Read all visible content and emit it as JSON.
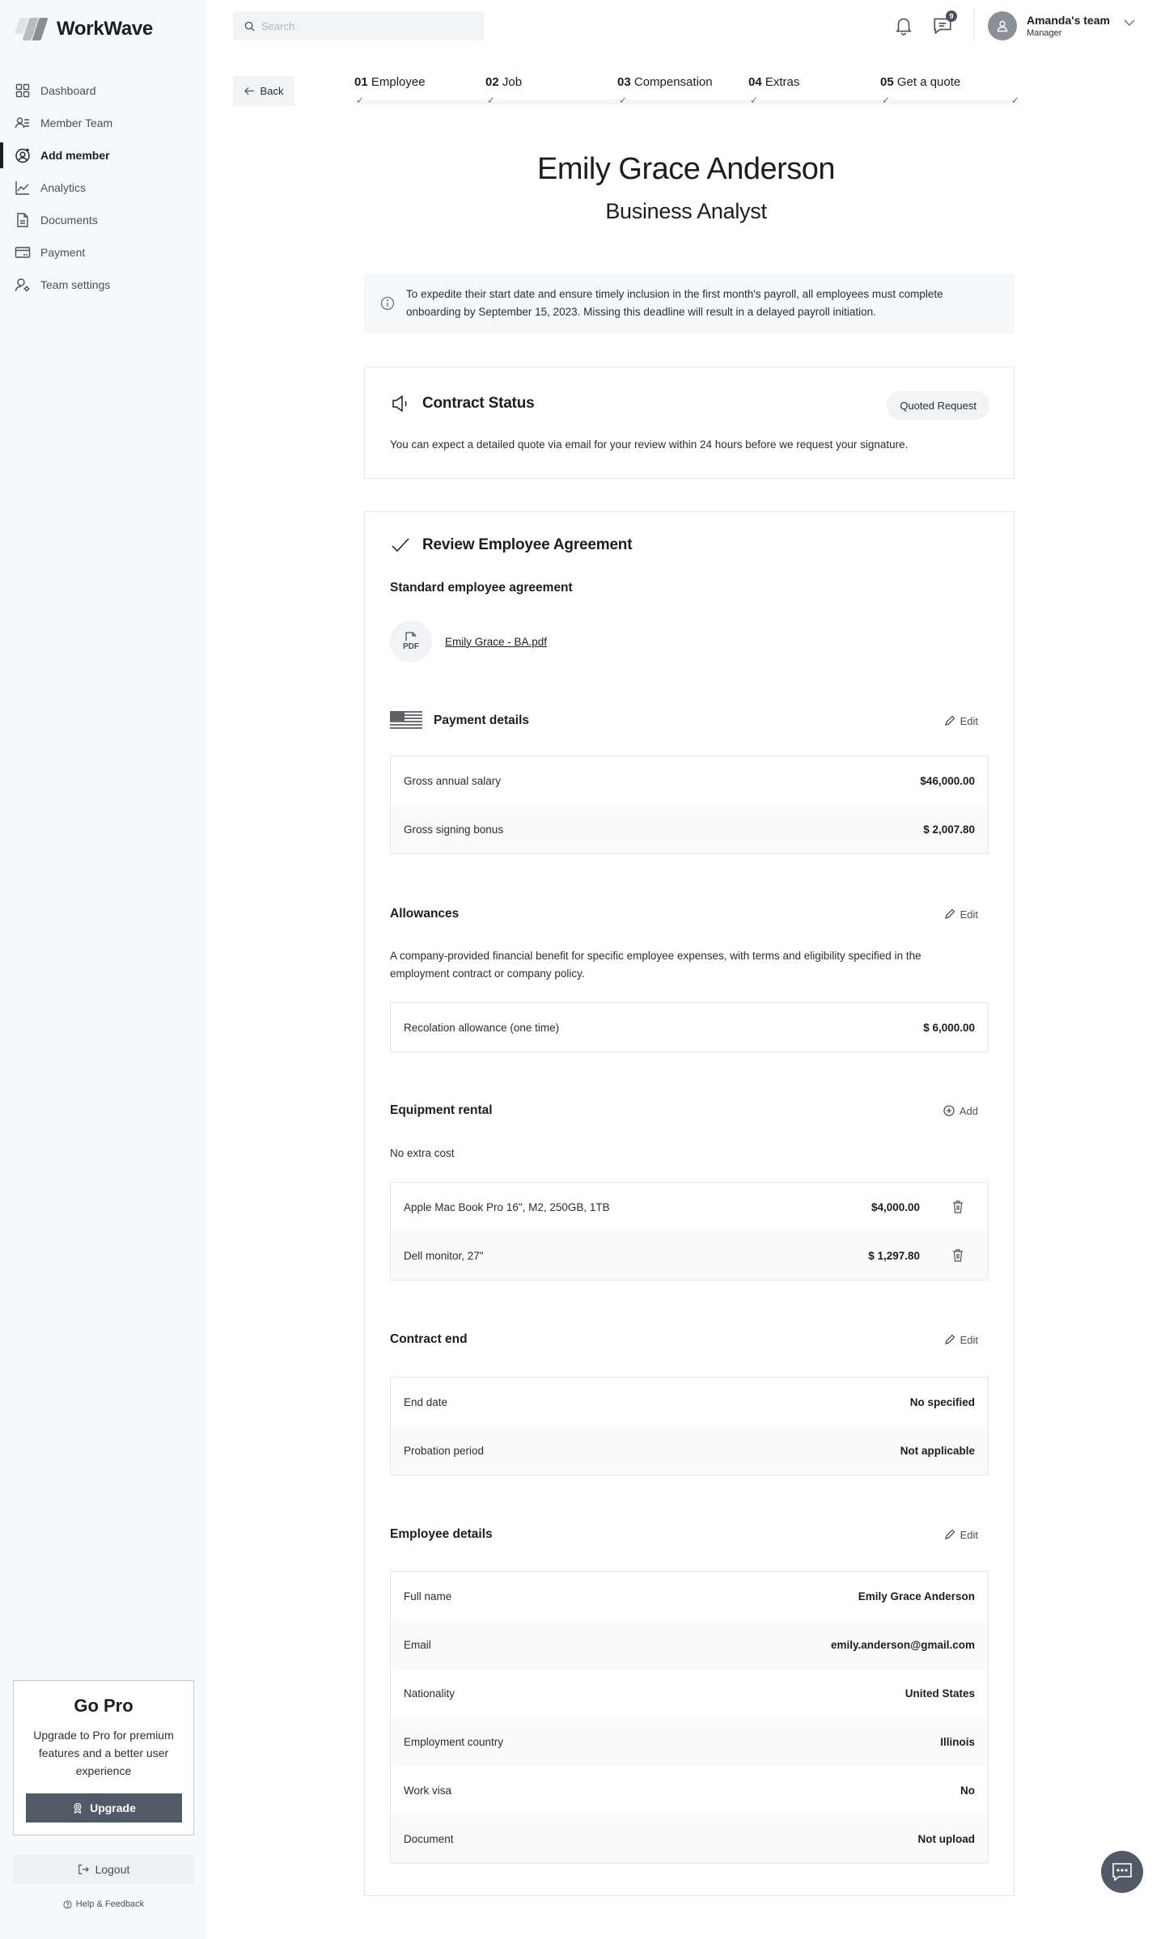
{
  "app": {
    "name": "WorkWave"
  },
  "sidebar": {
    "items": [
      {
        "label": "Dashboard",
        "icon": "dashboard-icon",
        "active": false
      },
      {
        "label": "Member Team",
        "icon": "member-list-icon",
        "active": false
      },
      {
        "label": "Add member",
        "icon": "add-user-icon",
        "active": true
      },
      {
        "label": "Analytics",
        "icon": "chart-line-icon",
        "active": false
      },
      {
        "label": "Documents",
        "icon": "document-icon",
        "active": false
      },
      {
        "label": "Payment",
        "icon": "card-icon",
        "active": false
      },
      {
        "label": "Team settings",
        "icon": "user-gear-icon",
        "active": false
      }
    ],
    "gopro": {
      "title": "Go Pro",
      "text": "Upgrade to Pro for premium features and a better user experience",
      "button": "Upgrade"
    },
    "logout": "Logout",
    "help": "Help & Feedback"
  },
  "header": {
    "search_placeholder": "Search",
    "search_value": "",
    "messages_badge": "9",
    "profile": {
      "name": "Amanda's team",
      "role": "Manager"
    }
  },
  "nav": {
    "back": "Back",
    "steps": [
      {
        "num": "01",
        "label": "Employee",
        "done": true
      },
      {
        "num": "02",
        "label": "Job",
        "done": true
      },
      {
        "num": "03",
        "label": "Compensation",
        "done": true
      },
      {
        "num": "04",
        "label": "Extras",
        "done": true
      },
      {
        "num": "05",
        "label": "Get a quote",
        "done": true
      }
    ],
    "progress_percent": 100
  },
  "employee": {
    "name": "Emily Grace Anderson",
    "position": "Business Analyst"
  },
  "info_banner": "To expedite their start date and ensure timely inclusion in the first month's payroll, all employees must complete onboarding by September 15, 2023. Missing this deadline will result in a delayed payroll initiation.",
  "contract_status": {
    "title": "Contract Status",
    "status": "Quoted Request",
    "description": "You can expect a detailed quote via email for your review within 24 hours before we request your signature."
  },
  "review": {
    "title": "Review Employee Agreement",
    "agreement_label": "Standard employee agreement",
    "file": {
      "type": "PDF",
      "name": "Emily Grace - BA.pdf"
    },
    "payment": {
      "title": "Payment details",
      "action": "Edit",
      "rows": [
        {
          "label": "Gross annual salary",
          "value": "$46,000.00"
        },
        {
          "label": "Gross signing bonus",
          "value": "$ 2,007.80"
        }
      ]
    },
    "allowances": {
      "title": "Allowances",
      "action": "Edit",
      "description": "A company-provided financial benefit for specific employee expenses, with terms and eligibility specified in the employment contract or company policy.",
      "rows": [
        {
          "label": "Recolation allowance (one time)",
          "value": "$ 6,000.00"
        }
      ]
    },
    "equipment": {
      "title": "Equipment rental",
      "action": "Add",
      "note": "No extra cost",
      "rows": [
        {
          "label": "Apple Mac Book Pro 16\", M2, 250GB, 1TB",
          "value": "$4,000.00"
        },
        {
          "label": "Dell monitor, 27\"",
          "value": "$ 1,297.80"
        }
      ]
    },
    "contract_end": {
      "title": "Contract end",
      "action": "Edit",
      "rows": [
        {
          "label": "End date",
          "value": "No specified"
        },
        {
          "label": "Probation period",
          "value": "Not applicable"
        }
      ]
    },
    "employee_details": {
      "title": "Employee details",
      "action": "Edit",
      "rows": [
        {
          "label": "Full name",
          "value": "Emily Grace Anderson"
        },
        {
          "label": "Email",
          "value": "emily.anderson@gmail.com"
        },
        {
          "label": "Nationality",
          "value": "United States"
        },
        {
          "label": "Employment country",
          "value": "Illinois"
        },
        {
          "label": "Work visa",
          "value": "No"
        },
        {
          "label": "Document",
          "value": "Not upload"
        }
      ]
    }
  }
}
